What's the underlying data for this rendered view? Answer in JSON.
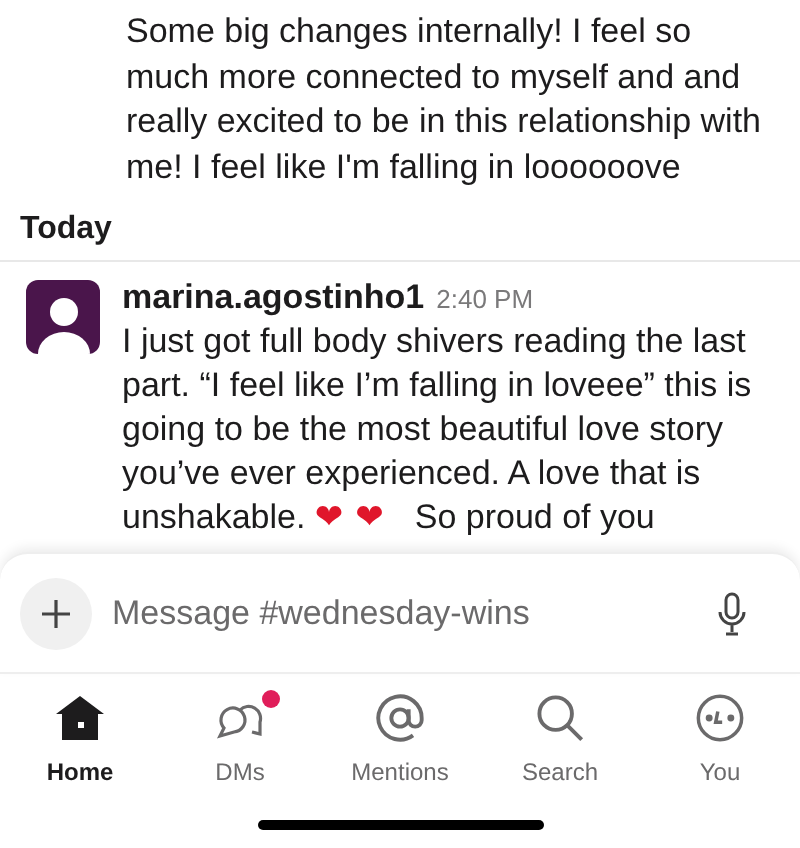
{
  "previous_message": {
    "text": "Some big changes internally! I feel so much more connected to myself and and really excited to be in this relationship with me! I feel like I'm falling in loooooove"
  },
  "day_divider": "Today",
  "message": {
    "author": "marina.agostinho1",
    "time": "2:40 PM",
    "body": [
      {
        "kind": "text",
        "text": "I just got full body shivers reading the last part. “I feel like I’m falling in loveee” this is going to be the most beautiful love story you’ve ever experienced. A love that is unshakable. "
      },
      {
        "kind": "emoji",
        "text": "❤"
      },
      {
        "kind": "emoji",
        "text": "❤"
      },
      {
        "kind": "text",
        "text": "  So proud of you"
      }
    ]
  },
  "composer": {
    "placeholder": "Message #wednesday-wins"
  },
  "tabs": [
    {
      "label": "Home",
      "selected": true,
      "badge": false
    },
    {
      "label": "DMs",
      "selected": false,
      "badge": true
    },
    {
      "label": "Mentions",
      "selected": false,
      "badge": false
    },
    {
      "label": "Search",
      "selected": false,
      "badge": false
    },
    {
      "label": "You",
      "selected": false,
      "badge": false
    }
  ]
}
